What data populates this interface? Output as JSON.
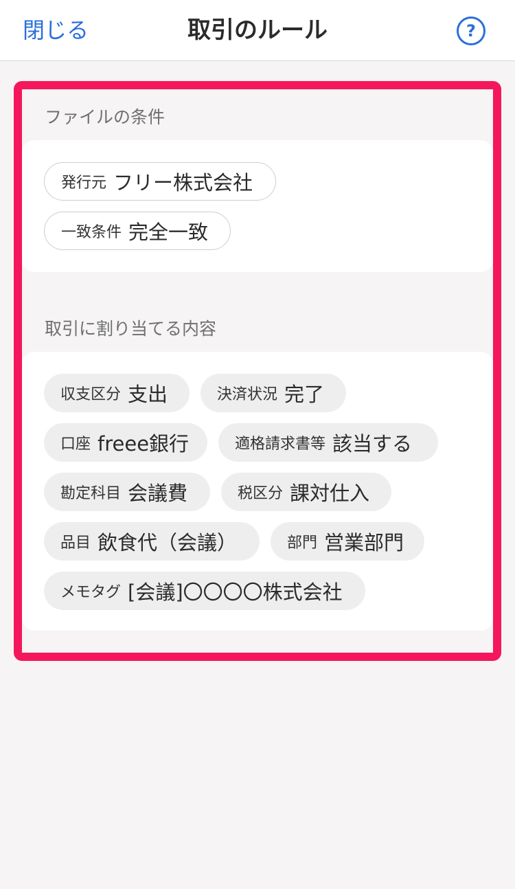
{
  "header": {
    "close_label": "閉じる",
    "title": "取引のルール",
    "help_label": "?"
  },
  "file_conditions": {
    "label": "ファイルの条件",
    "items": [
      {
        "key": "発行元",
        "value": "フリー株式会社"
      },
      {
        "key": "一致条件",
        "value": "完全一致"
      }
    ]
  },
  "assignments": {
    "label": "取引に割り当てる内容",
    "items": [
      {
        "key": "収支区分",
        "value": "支出"
      },
      {
        "key": "決済状況",
        "value": "完了"
      },
      {
        "key": "口座",
        "value": "freee銀行"
      },
      {
        "key": "適格請求書等",
        "value": "該当する"
      },
      {
        "key": "勘定科目",
        "value": "会議費"
      },
      {
        "key": "税区分",
        "value": "課対仕入"
      },
      {
        "key": "品目",
        "value": "飲食代（会議）"
      },
      {
        "key": "部門",
        "value": "営業部門"
      },
      {
        "key": "メモタグ",
        "value": "[会議]〇〇〇〇株式会社"
      }
    ]
  },
  "colors": {
    "accent": "#2a6fdb",
    "highlight": "#f5175c",
    "background": "#f6f4f5"
  }
}
